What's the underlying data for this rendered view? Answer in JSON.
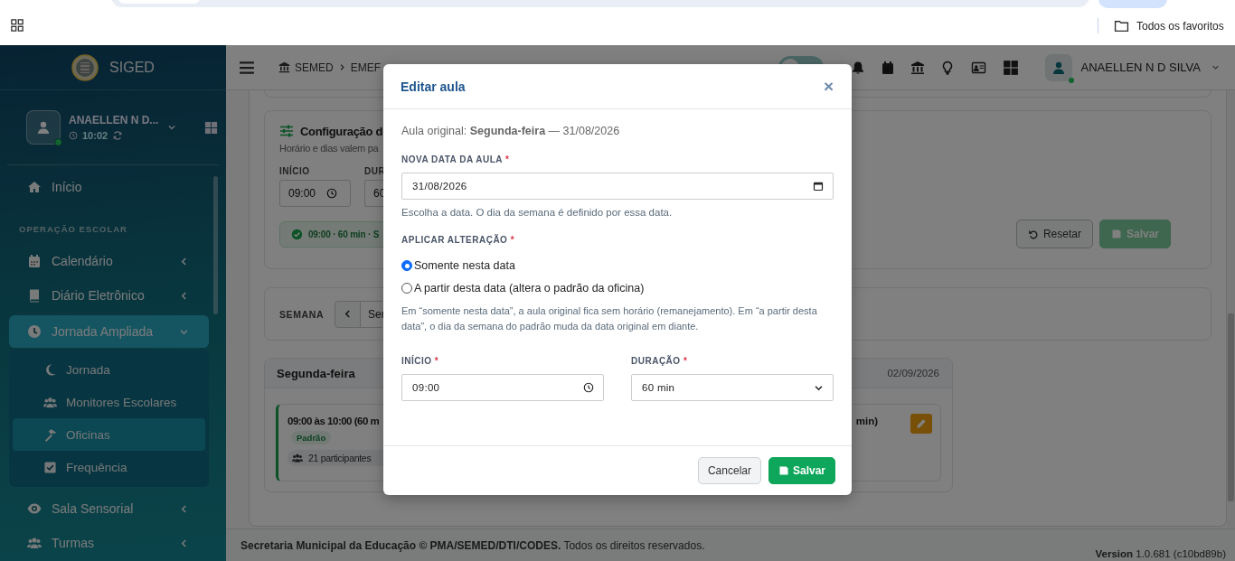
{
  "browser": {
    "bookmarks_label": "Todos os favoritos"
  },
  "sidebar": {
    "app_name": "SIGED",
    "user": {
      "name": "ANAELLEN N D...",
      "time": "10:02",
      "online": true
    },
    "items": [
      {
        "kind": "link",
        "label": "Início"
      },
      {
        "kind": "section",
        "label": "OPERAÇÃO ESCOLAR"
      },
      {
        "kind": "group",
        "label": "Calendário",
        "expanded": false
      },
      {
        "kind": "group",
        "label": "Diário Eletrônico",
        "expanded": false
      },
      {
        "kind": "group",
        "label": "Jornada Ampliada",
        "expanded": true,
        "children": [
          {
            "label": "Jornada",
            "selected": false
          },
          {
            "label": "Monitores Escolares",
            "selected": false
          },
          {
            "label": "Oficinas",
            "selected": true
          },
          {
            "label": "Frequência",
            "selected": false
          }
        ]
      },
      {
        "kind": "group",
        "label": "Sala Sensorial",
        "expanded": false
      },
      {
        "kind": "group",
        "label": "Turmas",
        "expanded": false
      }
    ]
  },
  "topbar": {
    "breadcrumb": [
      "SEMED",
      "EMEF"
    ],
    "theme_toggle": {
      "on": false
    },
    "user_name": "ANAELLEN N D SILVA"
  },
  "config": {
    "title": "Configuração d",
    "subtitle": "Horário e dias valem pa",
    "fields": [
      {
        "label": "INÍCIO",
        "value": "09:00"
      },
      {
        "label": "DUR",
        "value": "60"
      }
    ],
    "summary": "09:00 · 60 min · S",
    "buttons": [
      {
        "kind": "reset",
        "label": "Resetar",
        "disabled": false
      },
      {
        "kind": "save",
        "label": "Salvar",
        "disabled": true
      }
    ]
  },
  "week": {
    "label": "SEMANA",
    "value": "Ser"
  },
  "day": {
    "title": "Segunda-feira",
    "date": "02/09/2026",
    "lessons": [
      {
        "time": "09:00 às 10:00 (60 m",
        "tag": "Padrão",
        "participants": "21 participantes",
        "trailing_text": "min)"
      }
    ]
  },
  "footer": {
    "text": "**Secretaria Municipal da Educação © PMA/SEMED/DTI/CODES.** Todos os direitos reservados.",
    "version": "**Version** 1.0.681 (c10bd89b)"
  },
  "modal": {
    "title": "Editar aula",
    "close": "×",
    "original": "Aula original: **Segunda-feira** — 31/08/2026",
    "date_field": {
      "label": "NOVA DATA DA AULA",
      "required_mark": "*",
      "value": "31/08/2026",
      "help": "Escolha a data. O dia da semana é definido por essa data."
    },
    "apply": {
      "label": "APLICAR ALTERAÇÃO",
      "required_mark": "*",
      "options": [
        {
          "label": "Somente nesta data",
          "selected": true
        },
        {
          "label": "A partir desta data (altera o padrão da oficina)",
          "selected": false
        }
      ],
      "note": "Em “somente nesta data”, a aula original fica sem horário (remanejamento). Em “a partir desta data”, o dia da semana do padrão muda da data original em diante."
    },
    "start_field": {
      "label": "INÍCIO",
      "required_mark": "*",
      "value": "09:00"
    },
    "duration_field": {
      "label": "DURAÇÃO",
      "required_mark": "*",
      "value": "60 min"
    },
    "buttons": [
      {
        "kind": "cancel",
        "label": "Cancelar"
      },
      {
        "kind": "save",
        "label": "Salvar"
      }
    ]
  }
}
